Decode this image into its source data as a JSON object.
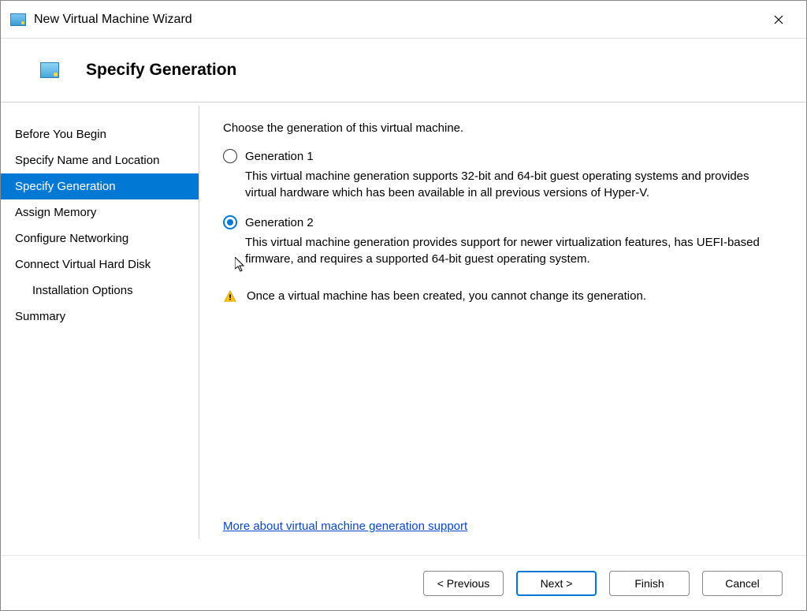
{
  "window": {
    "title": "New Virtual Machine Wizard"
  },
  "header": {
    "title": "Specify Generation"
  },
  "sidebar": {
    "items": [
      {
        "label": "Before You Begin"
      },
      {
        "label": "Specify Name and Location"
      },
      {
        "label": "Specify Generation"
      },
      {
        "label": "Assign Memory"
      },
      {
        "label": "Configure Networking"
      },
      {
        "label": "Connect Virtual Hard Disk"
      },
      {
        "label": "Installation Options"
      },
      {
        "label": "Summary"
      }
    ]
  },
  "main": {
    "intro": "Choose the generation of this virtual machine.",
    "option1": {
      "label": "Generation 1",
      "desc": "This virtual machine generation supports 32-bit and 64-bit guest operating systems and provides virtual hardware which has been available in all previous versions of Hyper-V."
    },
    "option2": {
      "label": "Generation 2",
      "desc": "This virtual machine generation provides support for newer virtualization features, has UEFI-based firmware, and requires a supported 64-bit guest operating system."
    },
    "warning": "Once a virtual machine has been created, you cannot change its generation.",
    "help_link": "More about virtual machine generation support"
  },
  "footer": {
    "previous": "< Previous",
    "next": "Next >",
    "finish": "Finish",
    "cancel": "Cancel"
  }
}
